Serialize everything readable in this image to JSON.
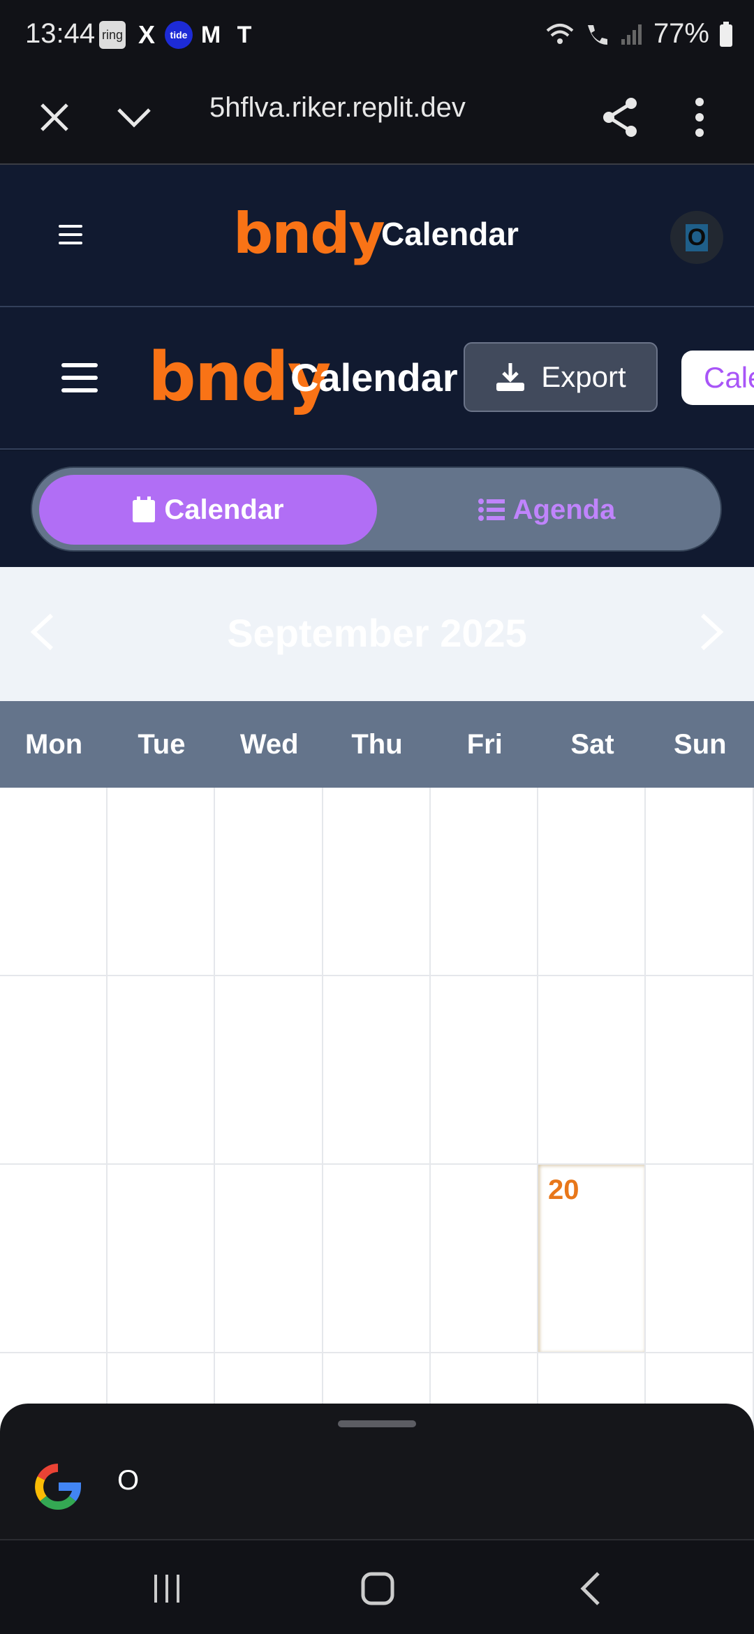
{
  "status_bar": {
    "time": "13:44",
    "apps": [
      "ring",
      "X",
      "tide",
      "M",
      "T"
    ],
    "battery": "77%"
  },
  "browser": {
    "url": "5hflva.riker.replit.dev",
    "icons": [
      "close-icon",
      "chevron-down-icon",
      "share-icon",
      "more-vert-icon"
    ]
  },
  "header1": {
    "logo": "bndy",
    "title": "Calendar",
    "avatar_letter": "O"
  },
  "header2": {
    "logo": "bndy",
    "title": "Calendar",
    "export_label": "Export",
    "calendar_button_label": "Cale"
  },
  "view_toggle": {
    "calendar_label": "Calendar",
    "agenda_label": "Agenda",
    "active": "calendar"
  },
  "calendar": {
    "month_title": "September 2025",
    "weekdays": [
      "Mon",
      "Tue",
      "Wed",
      "Thu",
      "Fri",
      "Sat",
      "Sun"
    ],
    "highlighted_day": "20"
  },
  "google_sheet": {
    "query": "O"
  },
  "colors": {
    "brand_orange": "#f97316",
    "accent_purple": "#b16ef5",
    "header_bg": "#111a30",
    "weekday_bg": "#64748b"
  }
}
